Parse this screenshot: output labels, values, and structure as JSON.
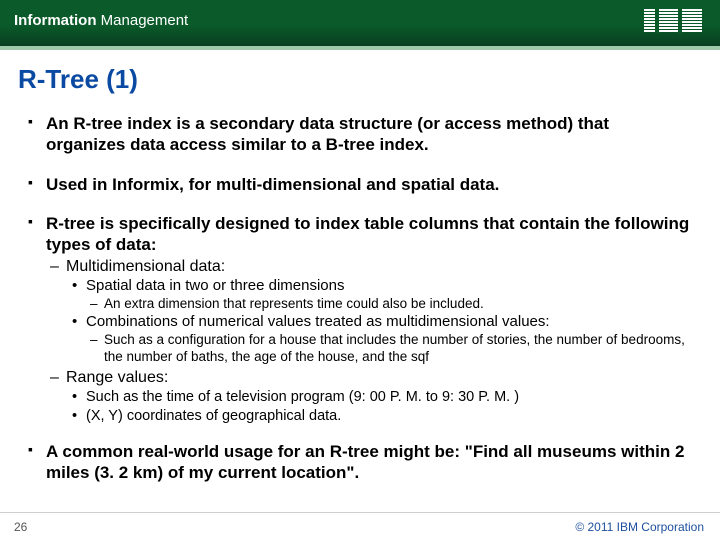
{
  "header": {
    "brand_bold": "Information",
    "brand_light": "Management",
    "logo_alt": "IBM"
  },
  "title": "R-Tree (1)",
  "bullets": {
    "p1": "An R-tree index is a secondary data structure (or access method) that organizes data access similar to a B-tree index.",
    "p2": "Used in Informix, for multi-dimensional and spatial data.",
    "p3": "R-tree is specifically designed to index table columns that contain the following types of data:",
    "p3a": "Multidimensional data:",
    "p3a1": "Spatial data in two or three dimensions",
    "p3a1a": "An extra dimension that represents time could also be included.",
    "p3a2": "Combinations of numerical values treated as multidimensional values:",
    "p3a2a": "Such as a configuration for a house that includes the number of stories, the number of bedrooms, the number of baths, the age of the house, and the sqf",
    "p3b": "Range values:",
    "p3b1": "Such as the time of a television program (9: 00 P. M. to 9: 30 P. M. )",
    "p3b2": "(X, Y) coordinates of geographical data.",
    "p4": "A common real-world usage for an R-tree might be: \"Find all museums within 2 miles (3. 2 km) of my current location\"."
  },
  "footer": {
    "page": "26",
    "copyright": "© 2011 IBM Corporation"
  }
}
